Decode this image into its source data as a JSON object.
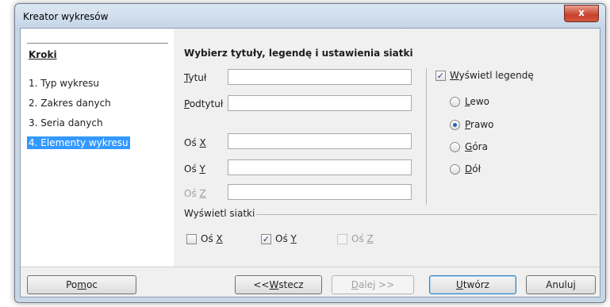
{
  "window": {
    "title": "Kreator wykresów",
    "close_label": "x"
  },
  "steps": {
    "heading": "Kroki",
    "items": [
      {
        "label": "1. Typ wykresu"
      },
      {
        "label": "2. Zakres danych"
      },
      {
        "label": "3. Seria danych"
      },
      {
        "label": "4. Elementy wykresu"
      }
    ]
  },
  "panel": {
    "heading": "Wybierz tytuły, legendę i ustawienia siatki",
    "title_label": {
      "pre": "",
      "key": "T",
      "post": "ytuł"
    },
    "subtitle_label": {
      "pre": "",
      "key": "P",
      "post": "odtytuł"
    },
    "x_axis_label": {
      "pre": "Oś ",
      "key": "X",
      "post": ""
    },
    "y_axis_label": {
      "pre": "Oś ",
      "key": "Y",
      "post": ""
    },
    "z_axis_label": {
      "pre": "Oś ",
      "key": "Z",
      "post": ""
    },
    "title_value": "",
    "subtitle_value": "",
    "x_axis_value": "",
    "y_axis_value": "",
    "z_axis_value": ""
  },
  "legend": {
    "show_label": {
      "pre": "",
      "key": "W",
      "post": "yświetl legendę"
    },
    "show_checked": true,
    "left": {
      "pre": "",
      "key": "L",
      "post": "ewo"
    },
    "right": {
      "pre": "",
      "key": "P",
      "post": "rawo"
    },
    "top": {
      "pre": "",
      "key": "G",
      "post": "óra"
    },
    "bottom": {
      "pre": "",
      "key": "D",
      "post": "ół"
    },
    "selected": "right"
  },
  "grid": {
    "heading": "Wyświetl siatki",
    "x": {
      "pre": "Oś ",
      "key": "X",
      "post": "",
      "checked": false
    },
    "y": {
      "pre": "Oś ",
      "key": "Y",
      "post": "",
      "checked": true
    },
    "z": {
      "pre": "Oś ",
      "key": "Z",
      "post": "",
      "checked": false
    }
  },
  "buttons": {
    "help": {
      "pre": "Po",
      "key": "m",
      "post": "oc"
    },
    "back": {
      "pre": "<< ",
      "key": "W",
      "post": "stecz"
    },
    "next": {
      "pre": "",
      "key": "D",
      "post": "alej >>"
    },
    "finish": {
      "pre": "",
      "key": "U",
      "post": "twórz"
    },
    "cancel": {
      "pre": "Anuluj",
      "key": "",
      "post": ""
    }
  },
  "colors": {
    "selection": "#3399ff",
    "close": "#c7402b"
  },
  "icons": {
    "check": "check-icon",
    "radio": "radio-dot-icon"
  }
}
